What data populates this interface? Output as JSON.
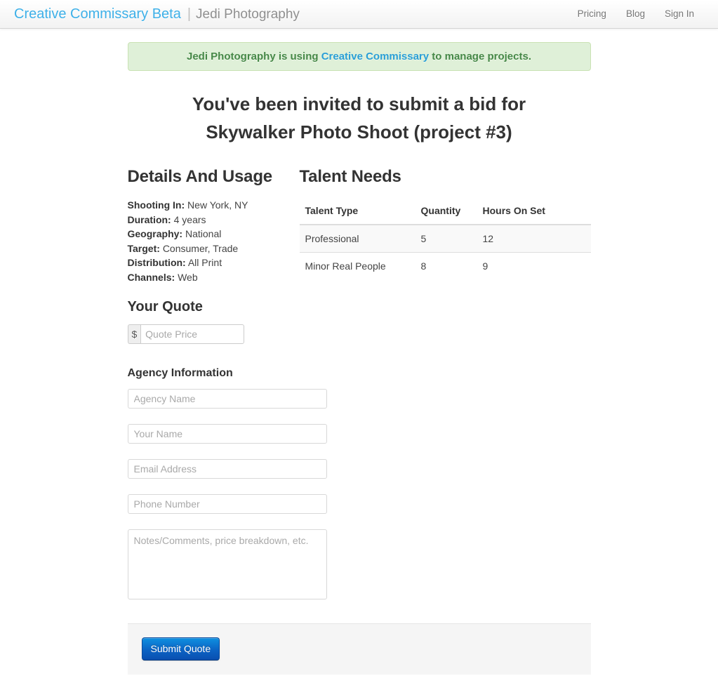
{
  "navbar": {
    "brand": "Creative Commissary Beta",
    "separator": "|",
    "subtitle": "Jedi Photography",
    "links": [
      {
        "label": "Pricing"
      },
      {
        "label": "Blog"
      },
      {
        "label": "Sign In"
      }
    ]
  },
  "alert": {
    "prefix": "Jedi Photography is using ",
    "link": "Creative Commissary",
    "suffix": " to manage projects."
  },
  "heading": {
    "line1": "You've been invited to submit a bid for",
    "line2": "Skywalker Photo Shoot (project #3)"
  },
  "details": {
    "title": "Details And Usage",
    "rows": [
      {
        "key": "Shooting In:",
        "value": "New York, NY"
      },
      {
        "key": "Duration:",
        "value": "4 years"
      },
      {
        "key": "Geography:",
        "value": "National"
      },
      {
        "key": "Target:",
        "value": "Consumer, Trade"
      },
      {
        "key": "Distribution:",
        "value": "All Print"
      },
      {
        "key": "Channels:",
        "value": "Web"
      }
    ]
  },
  "talent": {
    "title": "Talent Needs",
    "columns": [
      "Talent Type",
      "Quantity",
      "Hours On Set"
    ],
    "rows": [
      {
        "type": "Professional",
        "quantity": "5",
        "hours": "12"
      },
      {
        "type": "Minor Real People",
        "quantity": "8",
        "hours": "9"
      }
    ]
  },
  "quote": {
    "title": "Your Quote",
    "currency_symbol": "$",
    "price_placeholder": "Quote Price",
    "price_value": ""
  },
  "agency": {
    "title": "Agency Information",
    "fields": [
      {
        "name": "agency-name",
        "placeholder": "Agency Name",
        "value": ""
      },
      {
        "name": "your-name",
        "placeholder": "Your Name",
        "value": ""
      },
      {
        "name": "email-address",
        "placeholder": "Email Address",
        "value": ""
      },
      {
        "name": "phone-number",
        "placeholder": "Phone Number",
        "value": ""
      }
    ],
    "notes_placeholder": "Notes/Comments, price breakdown, etc.",
    "notes_value": ""
  },
  "actions": {
    "submit_label": "Submit Quote"
  },
  "colors": {
    "brand": "#3eb0e8",
    "alert_bg": "#dff0d8",
    "alert_text": "#468847",
    "alert_link": "#2a9fd6",
    "primary_button": "#0b63c4",
    "text": "#333333"
  }
}
